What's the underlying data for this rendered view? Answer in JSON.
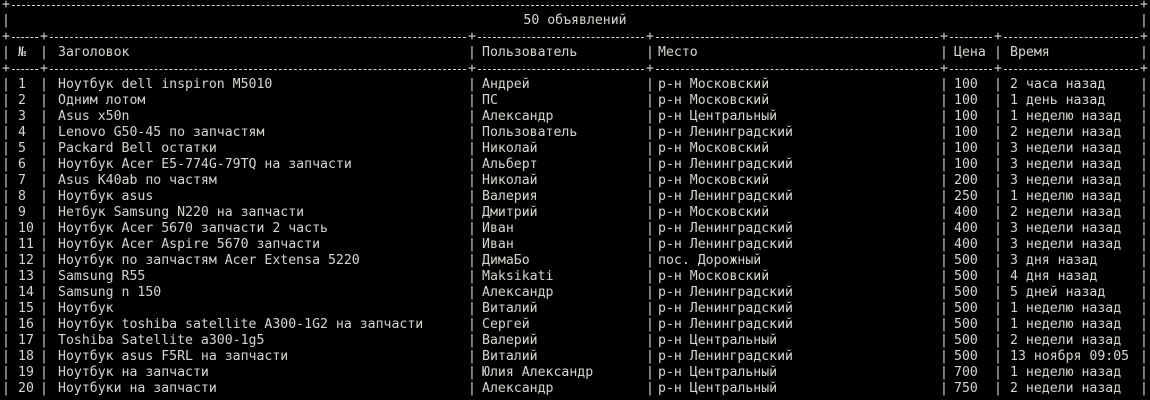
{
  "title": "50 объявлений",
  "columns": {
    "num": "№",
    "title": "Заголовок",
    "user": "Пользователь",
    "place": "Место",
    "price": "Цена",
    "time": "Время"
  },
  "rows": [
    {
      "num": "1",
      "title": "Ноутбук dell inspiron M5010",
      "user": "Андрей",
      "place": "р-н Московский",
      "price": "100",
      "time": "2 часа назад"
    },
    {
      "num": "2",
      "title": "Одним лотом",
      "user": "ПС",
      "place": "р-н Московский",
      "price": "100",
      "time": "1 день назад"
    },
    {
      "num": "3",
      "title": "Asus x50n",
      "user": "Александр",
      "place": "р-н Центральный",
      "price": "100",
      "time": "1 неделю назад"
    },
    {
      "num": "4",
      "title": "Lenovo G50-45 по запчастям",
      "user": "Пользователь",
      "place": "р-н Ленинградский",
      "price": "100",
      "time": "2 недели назад"
    },
    {
      "num": "5",
      "title": "Packard Bell остатки",
      "user": "Николай",
      "place": "р-н Московский",
      "price": "100",
      "time": "3 недели назад"
    },
    {
      "num": "6",
      "title": "Ноутбук Acer E5-774G-79TQ на запчасти",
      "user": "Альберт",
      "place": "р-н Ленинградский",
      "price": "100",
      "time": "3 недели назад"
    },
    {
      "num": "7",
      "title": "Asus K40ab по частям",
      "user": "Николай",
      "place": "р-н Московский",
      "price": "200",
      "time": "3 недели назад"
    },
    {
      "num": "8",
      "title": "Ноутбук asus",
      "user": "Валерия",
      "place": "р-н Ленинградский",
      "price": "250",
      "time": "1 неделю назад"
    },
    {
      "num": "9",
      "title": "Нетбук Samsung N220 на запчасти",
      "user": "Дмитрий",
      "place": "р-н Московский",
      "price": "400",
      "time": "2 недели назад"
    },
    {
      "num": "10",
      "title": "Ноутбук Acer 5670 запчасти 2 часть",
      "user": "Иван",
      "place": "р-н Ленинградский",
      "price": "400",
      "time": "3 недели назад"
    },
    {
      "num": "11",
      "title": "Ноутбук Acer Aspire 5670 запчасти",
      "user": "Иван",
      "place": "р-н Ленинградский",
      "price": "400",
      "time": "3 недели назад"
    },
    {
      "num": "12",
      "title": "Ноутбук по запчастям Acer Extensa 5220",
      "user": "ДимаБо",
      "place": "пос. Дорожный",
      "price": "500",
      "time": "3 дня назад"
    },
    {
      "num": "13",
      "title": "Samsung R55",
      "user": "Maksikati",
      "place": "р-н Московский",
      "price": "500",
      "time": "4 дня назад"
    },
    {
      "num": "14",
      "title": "Samsung n 150",
      "user": "Александр",
      "place": "р-н Ленинградский",
      "price": "500",
      "time": "5 дней назад"
    },
    {
      "num": "15",
      "title": "Ноутбук",
      "user": "Виталий",
      "place": "р-н Ленинградский",
      "price": "500",
      "time": "1 неделю назад"
    },
    {
      "num": "16",
      "title": "Ноутбук toshiba satellite A300-1G2 на запчасти",
      "user": "Сергей",
      "place": "р-н Ленинградский",
      "price": "500",
      "time": "1 неделю назад"
    },
    {
      "num": "17",
      "title": "Toshiba Satellite a300-1g5",
      "user": "Валерий",
      "place": "р-н Центральный",
      "price": "500",
      "time": "2 недели назад"
    },
    {
      "num": "18",
      "title": "Ноутбук asus F5RL на запчасти",
      "user": "Виталий",
      "place": "р-н Ленинградский",
      "price": "500",
      "time": "13 ноября 09:05"
    },
    {
      "num": "19",
      "title": "Ноутбук на запчасти",
      "user": "Юлия Александр",
      "place": "р-н Центральный",
      "price": "700",
      "time": "1 неделю назад"
    },
    {
      "num": "20",
      "title": "Ноутбуки на запчасти",
      "user": "Александр",
      "place": "р-н Центральный",
      "price": "750",
      "time": "2 недели назад"
    }
  ]
}
